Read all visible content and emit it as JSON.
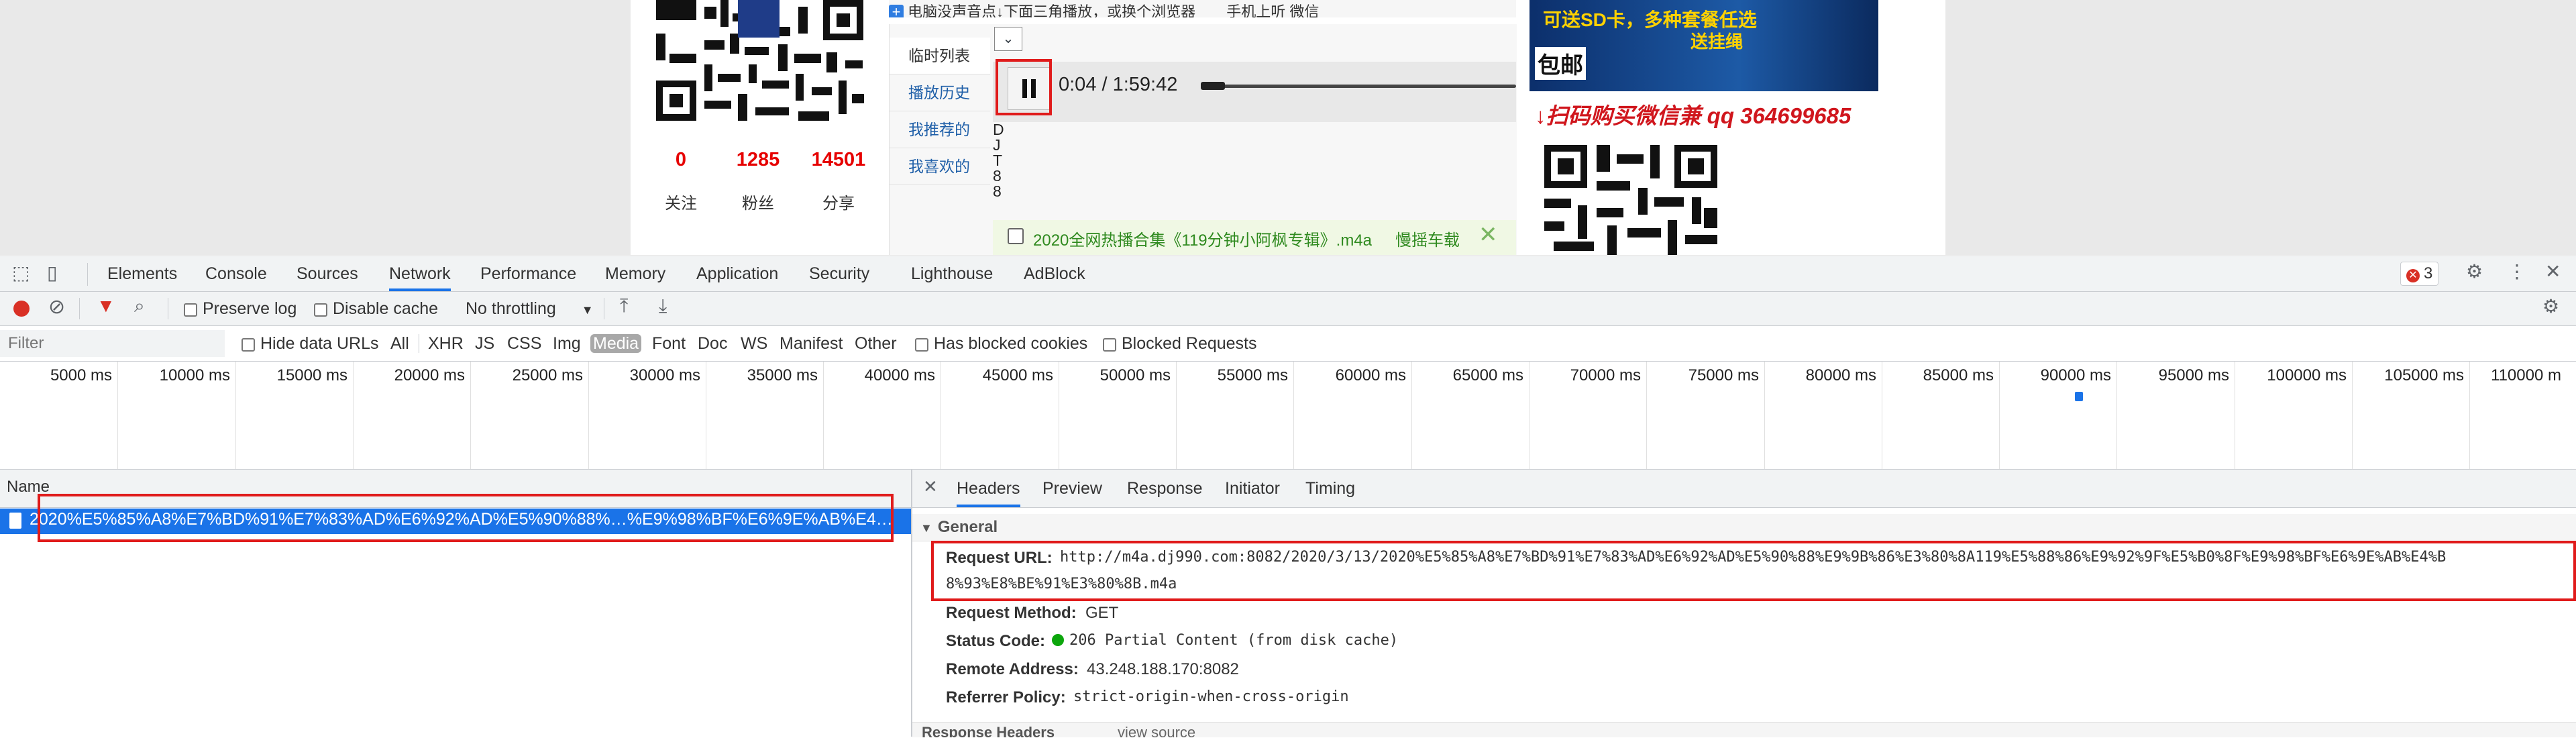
{
  "page": {
    "top_strip_text": "电脑没声音点↓下面三角播放，或换个浏览器",
    "top_strip_extra": "手机上听  微信",
    "stats": [
      {
        "value": "0",
        "label": "关注"
      },
      {
        "value": "1285",
        "label": "粉丝"
      },
      {
        "value": "14501",
        "label": "分享"
      }
    ],
    "player_tabs": [
      "临时列表",
      "播放历史",
      "我推荐的",
      "我喜欢的"
    ],
    "time_display": "0:04 / 1:59:42",
    "progress_fraction": 0.0006,
    "vertical_text": [
      "D",
      "J",
      "T",
      "8",
      "8"
    ],
    "song_name": "2020全网热播合集《119分钟小阿枫专辑》.m4a",
    "song_action": "慢摇车载",
    "ad_title": "可送SD卡，多种套餐任选",
    "ad_sub": "送挂绳",
    "ad_mail": "包邮",
    "ad_qq": "↓扫码购买微信兼 qq 364699685"
  },
  "devtools": {
    "tabs": [
      "Elements",
      "Console",
      "Sources",
      "Network",
      "Performance",
      "Memory",
      "Application",
      "Security",
      "Lighthouse",
      "AdBlock"
    ],
    "active_tab": "Network",
    "error_count": "3",
    "toolbar": {
      "preserve_log": "Preserve log",
      "disable_cache": "Disable cache",
      "throttling": "No throttling"
    },
    "filter": {
      "placeholder": "Filter",
      "hide_data_urls": "Hide data URLs",
      "types": [
        "All",
        "XHR",
        "JS",
        "CSS",
        "Img",
        "Media",
        "Font",
        "Doc",
        "WS",
        "Manifest",
        "Other"
      ],
      "active_type": "Media",
      "has_blocked_cookies": "Has blocked cookies",
      "blocked_requests": "Blocked Requests"
    },
    "timeline_ticks": [
      "5000 ms",
      "10000 ms",
      "15000 ms",
      "20000 ms",
      "25000 ms",
      "30000 ms",
      "35000 ms",
      "40000 ms",
      "45000 ms",
      "50000 ms",
      "55000 ms",
      "60000 ms",
      "65000 ms",
      "70000 ms",
      "75000 ms",
      "80000 ms",
      "85000 ms",
      "90000 ms",
      "95000 ms",
      "100000 ms",
      "105000 ms",
      "110000 m"
    ],
    "request_list": {
      "header": "Name",
      "rows": [
        "2020%E5%85%A8%E7%BD%91%E7%83%AD%E6%92%AD%E5%90%88%…%E9%98%BF%E6%9E%AB%E4…"
      ]
    },
    "detail": {
      "tabs": [
        "Headers",
        "Preview",
        "Response",
        "Initiator",
        "Timing"
      ],
      "active_tab": "Headers",
      "section": "General",
      "request_url_label": "Request URL:",
      "request_url_line1": "http://m4a.dj990.com:8082/2020/3/13/2020%E5%85%A8%E7%BD%91%E7%83%AD%E6%92%AD%E5%90%88%E9%9B%86%E3%80%8A119%E5%88%86%E9%92%9F%E5%B0%8F%E9%98%BF%E6%9E%AB%E4%B",
      "request_url_line2": "8%93%E8%BE%91%E3%80%8B.m4a",
      "request_method_label": "Request Method:",
      "request_method": "GET",
      "status_code_label": "Status Code:",
      "status_code": "206 Partial Content (from disk cache)",
      "remote_address_label": "Remote Address:",
      "remote_address": "43.248.188.170:8082",
      "referrer_policy_label": "Referrer Policy:",
      "referrer_policy": "strict-origin-when-cross-origin",
      "next_section": "Response Headers",
      "next_section_link": "view source"
    }
  }
}
